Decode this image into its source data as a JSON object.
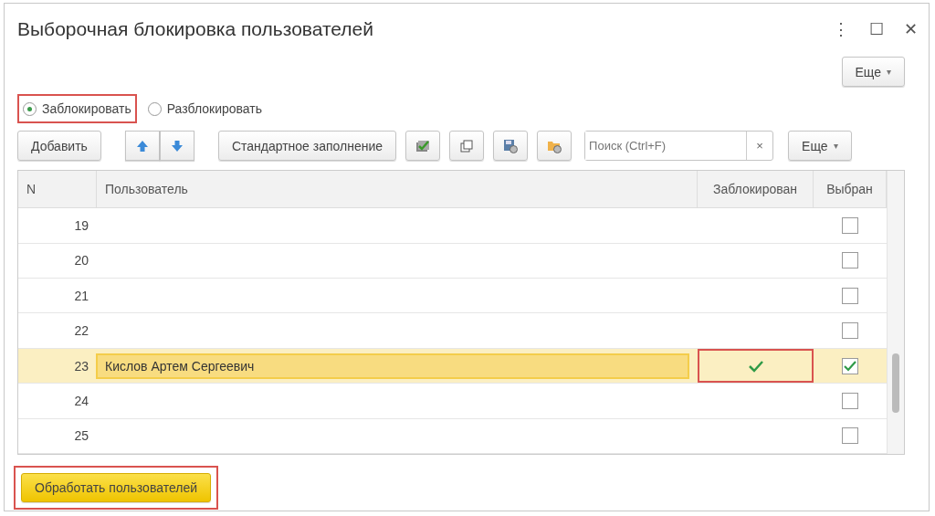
{
  "window": {
    "title": "Выборочная блокировка пользователей",
    "menu_icon": "⋮",
    "maximize_icon": "☐",
    "close_icon": "✕"
  },
  "top_more": {
    "label": "Еще",
    "caret": "▾"
  },
  "mode": [
    {
      "label": "Заблокировать",
      "selected": true,
      "highlighted": true
    },
    {
      "label": "Разблокировать",
      "selected": false,
      "highlighted": false
    }
  ],
  "toolbar": {
    "add": "Добавить",
    "fill": "Стандартное заполнение",
    "search": {
      "placeholder": "Поиск (Ctrl+F)",
      "clear": "×"
    },
    "more": {
      "label": "Еще",
      "caret": "▾"
    }
  },
  "table": {
    "columns": [
      "N",
      "Пользователь",
      "Заблокирован",
      "Выбран"
    ],
    "rows": [
      {
        "n": "19",
        "selected": false,
        "blocked": false,
        "checked": false,
        "highlighted": false
      },
      {
        "n": "20",
        "selected": false,
        "blocked": false,
        "checked": false,
        "highlighted": false
      },
      {
        "n": "21",
        "selected": false,
        "blocked": false,
        "checked": false,
        "highlighted": false
      },
      {
        "n": "22",
        "selected": false,
        "blocked": false,
        "checked": false,
        "highlighted": false
      },
      {
        "n": "23",
        "name": "Кислов Артем Сергеевич",
        "selected": true,
        "blocked": true,
        "checked": true,
        "highlighted": true
      },
      {
        "n": "24",
        "selected": false,
        "blocked": false,
        "checked": false,
        "highlighted": false
      },
      {
        "n": "25",
        "selected": false,
        "blocked": false,
        "checked": false,
        "highlighted": false
      }
    ]
  },
  "process_button": {
    "label": "Обработать пользователей",
    "highlighted": true
  }
}
